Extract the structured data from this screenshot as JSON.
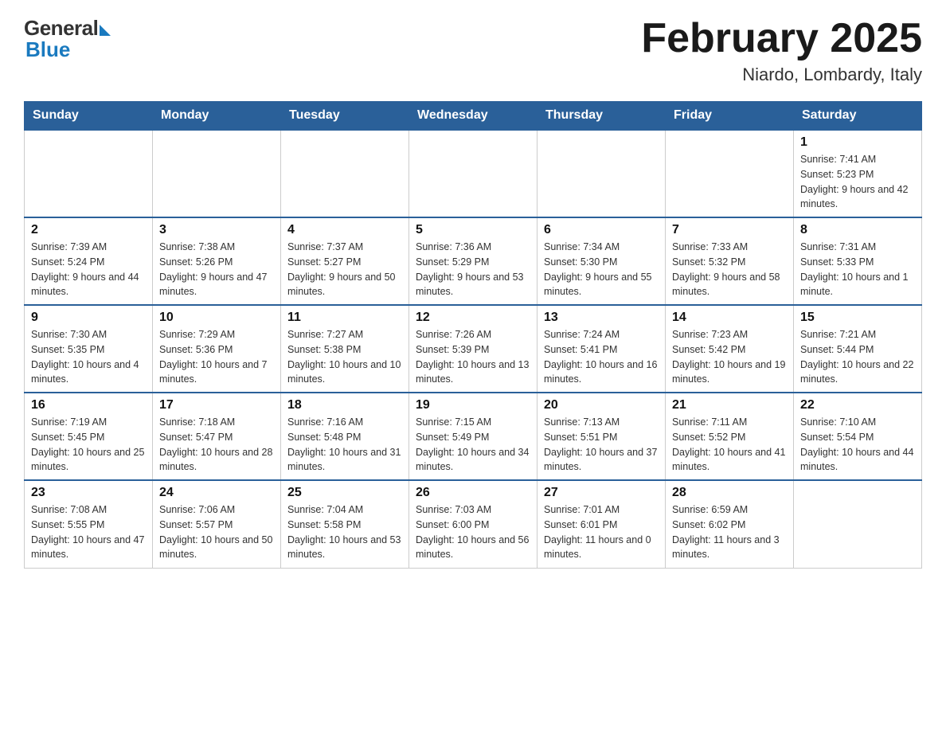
{
  "header": {
    "logo_general": "General",
    "logo_blue": "Blue",
    "month_title": "February 2025",
    "location": "Niardo, Lombardy, Italy"
  },
  "weekdays": [
    "Sunday",
    "Monday",
    "Tuesday",
    "Wednesday",
    "Thursday",
    "Friday",
    "Saturday"
  ],
  "weeks": [
    [
      {
        "day": "",
        "info": ""
      },
      {
        "day": "",
        "info": ""
      },
      {
        "day": "",
        "info": ""
      },
      {
        "day": "",
        "info": ""
      },
      {
        "day": "",
        "info": ""
      },
      {
        "day": "",
        "info": ""
      },
      {
        "day": "1",
        "info": "Sunrise: 7:41 AM\nSunset: 5:23 PM\nDaylight: 9 hours and 42 minutes."
      }
    ],
    [
      {
        "day": "2",
        "info": "Sunrise: 7:39 AM\nSunset: 5:24 PM\nDaylight: 9 hours and 44 minutes."
      },
      {
        "day": "3",
        "info": "Sunrise: 7:38 AM\nSunset: 5:26 PM\nDaylight: 9 hours and 47 minutes."
      },
      {
        "day": "4",
        "info": "Sunrise: 7:37 AM\nSunset: 5:27 PM\nDaylight: 9 hours and 50 minutes."
      },
      {
        "day": "5",
        "info": "Sunrise: 7:36 AM\nSunset: 5:29 PM\nDaylight: 9 hours and 53 minutes."
      },
      {
        "day": "6",
        "info": "Sunrise: 7:34 AM\nSunset: 5:30 PM\nDaylight: 9 hours and 55 minutes."
      },
      {
        "day": "7",
        "info": "Sunrise: 7:33 AM\nSunset: 5:32 PM\nDaylight: 9 hours and 58 minutes."
      },
      {
        "day": "8",
        "info": "Sunrise: 7:31 AM\nSunset: 5:33 PM\nDaylight: 10 hours and 1 minute."
      }
    ],
    [
      {
        "day": "9",
        "info": "Sunrise: 7:30 AM\nSunset: 5:35 PM\nDaylight: 10 hours and 4 minutes."
      },
      {
        "day": "10",
        "info": "Sunrise: 7:29 AM\nSunset: 5:36 PM\nDaylight: 10 hours and 7 minutes."
      },
      {
        "day": "11",
        "info": "Sunrise: 7:27 AM\nSunset: 5:38 PM\nDaylight: 10 hours and 10 minutes."
      },
      {
        "day": "12",
        "info": "Sunrise: 7:26 AM\nSunset: 5:39 PM\nDaylight: 10 hours and 13 minutes."
      },
      {
        "day": "13",
        "info": "Sunrise: 7:24 AM\nSunset: 5:41 PM\nDaylight: 10 hours and 16 minutes."
      },
      {
        "day": "14",
        "info": "Sunrise: 7:23 AM\nSunset: 5:42 PM\nDaylight: 10 hours and 19 minutes."
      },
      {
        "day": "15",
        "info": "Sunrise: 7:21 AM\nSunset: 5:44 PM\nDaylight: 10 hours and 22 minutes."
      }
    ],
    [
      {
        "day": "16",
        "info": "Sunrise: 7:19 AM\nSunset: 5:45 PM\nDaylight: 10 hours and 25 minutes."
      },
      {
        "day": "17",
        "info": "Sunrise: 7:18 AM\nSunset: 5:47 PM\nDaylight: 10 hours and 28 minutes."
      },
      {
        "day": "18",
        "info": "Sunrise: 7:16 AM\nSunset: 5:48 PM\nDaylight: 10 hours and 31 minutes."
      },
      {
        "day": "19",
        "info": "Sunrise: 7:15 AM\nSunset: 5:49 PM\nDaylight: 10 hours and 34 minutes."
      },
      {
        "day": "20",
        "info": "Sunrise: 7:13 AM\nSunset: 5:51 PM\nDaylight: 10 hours and 37 minutes."
      },
      {
        "day": "21",
        "info": "Sunrise: 7:11 AM\nSunset: 5:52 PM\nDaylight: 10 hours and 41 minutes."
      },
      {
        "day": "22",
        "info": "Sunrise: 7:10 AM\nSunset: 5:54 PM\nDaylight: 10 hours and 44 minutes."
      }
    ],
    [
      {
        "day": "23",
        "info": "Sunrise: 7:08 AM\nSunset: 5:55 PM\nDaylight: 10 hours and 47 minutes."
      },
      {
        "day": "24",
        "info": "Sunrise: 7:06 AM\nSunset: 5:57 PM\nDaylight: 10 hours and 50 minutes."
      },
      {
        "day": "25",
        "info": "Sunrise: 7:04 AM\nSunset: 5:58 PM\nDaylight: 10 hours and 53 minutes."
      },
      {
        "day": "26",
        "info": "Sunrise: 7:03 AM\nSunset: 6:00 PM\nDaylight: 10 hours and 56 minutes."
      },
      {
        "day": "27",
        "info": "Sunrise: 7:01 AM\nSunset: 6:01 PM\nDaylight: 11 hours and 0 minutes."
      },
      {
        "day": "28",
        "info": "Sunrise: 6:59 AM\nSunset: 6:02 PM\nDaylight: 11 hours and 3 minutes."
      },
      {
        "day": "",
        "info": ""
      }
    ]
  ]
}
